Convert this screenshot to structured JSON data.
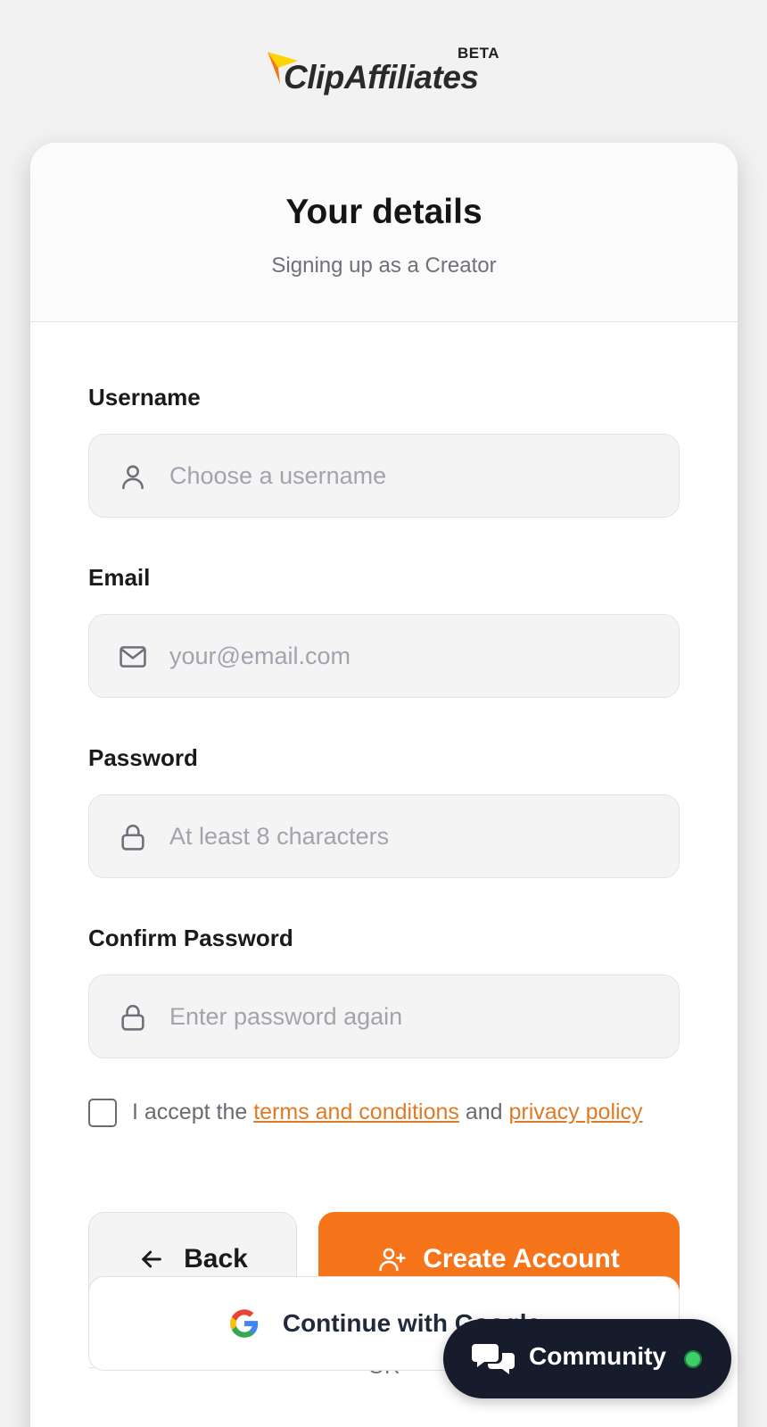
{
  "brand": {
    "name": "ClipAffiliates",
    "badge": "BETA",
    "accent_color": "#f7751a",
    "logo_colors": [
      "#f7751a",
      "#ffd400"
    ]
  },
  "header": {
    "title": "Your details",
    "subtitle": "Signing up as a Creator"
  },
  "form": {
    "username": {
      "label": "Username",
      "placeholder": "Choose a username",
      "value": "",
      "icon": "user-icon"
    },
    "email": {
      "label": "Email",
      "placeholder": "your@email.com",
      "value": "",
      "icon": "mail-icon"
    },
    "password": {
      "label": "Password",
      "placeholder": "At least 8 characters",
      "value": "",
      "icon": "lock-icon"
    },
    "confirm_password": {
      "label": "Confirm Password",
      "placeholder": "Enter password again",
      "value": "",
      "icon": "lock-icon"
    },
    "terms": {
      "checked": false,
      "prefix": "I accept the ",
      "terms_link": "terms and conditions",
      "middle": " and ",
      "privacy_link": "privacy policy"
    }
  },
  "actions": {
    "back_label": "Back",
    "create_label": "Create Account",
    "divider_text": "OR",
    "google_label": "Continue with Google"
  },
  "community": {
    "label": "Community",
    "status_color": "#3ecf68"
  }
}
